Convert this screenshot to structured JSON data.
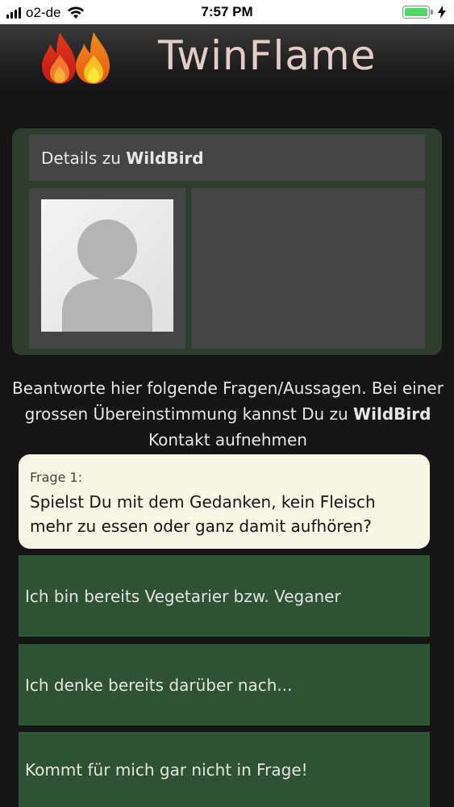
{
  "status_bar": {
    "carrier": "o2-de",
    "time": "7:57 PM",
    "battery_color": "#4cd964"
  },
  "header": {
    "title": "TwinFlame",
    "logo_icon": "twin-flame-logo"
  },
  "details": {
    "prefix": "Details zu ",
    "username": "WildBird",
    "avatar_icon": "default-user-avatar"
  },
  "intro": {
    "text_before": "Beantworte hier folgende Fragen/Aussagen. Bei einer grossen Übereinstimmung kannst Du zu ",
    "username": "WildBird",
    "text_after": " Kontakt aufnehmen"
  },
  "question": {
    "label": "Frage 1:",
    "text": "Spielst Du mit dem Gedanken, kein Fleisch mehr zu essen oder ganz damit aufhören?"
  },
  "answers": [
    {
      "label": "Ich bin bereits Vegetarier bzw. Veganer"
    },
    {
      "label": "Ich denke bereits darüber nach..."
    },
    {
      "label": "Kommt für mich gar nicht in Frage!"
    }
  ],
  "colors": {
    "background": "#151515",
    "card": "#2f3d2f",
    "answer": "#2e5233",
    "question_bg": "#f8f6e4",
    "title": "#e6ccc6"
  }
}
